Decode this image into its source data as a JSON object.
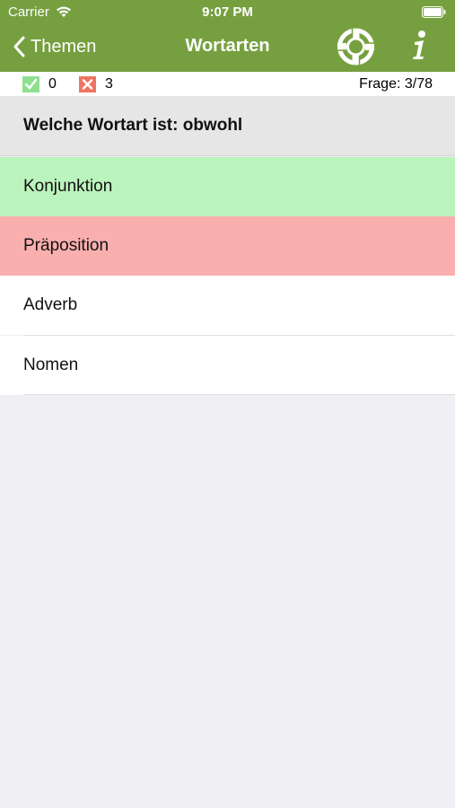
{
  "status": {
    "carrier": "Carrier",
    "time": "9:07 PM"
  },
  "nav": {
    "back_label": "Themen",
    "title": "Wortarten",
    "help_icon": "lifebuoy-icon",
    "info_icon": "info-icon"
  },
  "score": {
    "correct": "0",
    "wrong": "3",
    "counter": "Frage: 3/78"
  },
  "question": "Welche Wortart ist: obwohl",
  "answers": [
    {
      "label": "Konjunktion",
      "state": "correct"
    },
    {
      "label": "Präposition",
      "state": "wrong"
    },
    {
      "label": "Adverb",
      "state": "neutral"
    },
    {
      "label": "Nomen",
      "state": "neutral"
    }
  ],
  "colors": {
    "header": "#76a03f",
    "correct": "#bbf3bc",
    "wrong": "#f9afae",
    "background": "#efeff4"
  }
}
